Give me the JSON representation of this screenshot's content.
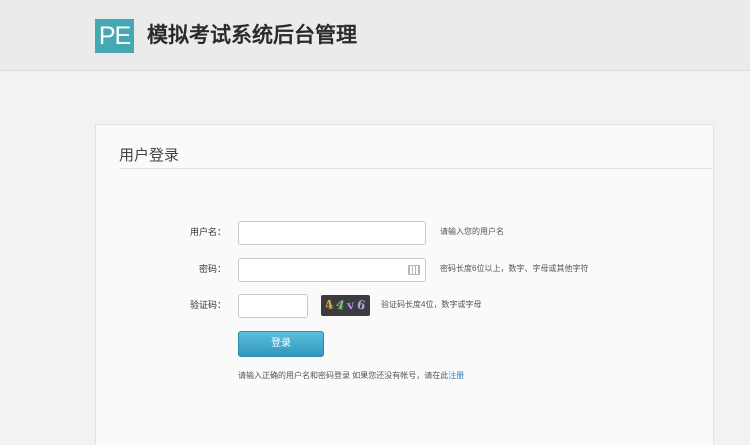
{
  "header": {
    "logo_text": "PE",
    "title": "模拟考试系统后台管理"
  },
  "login": {
    "panel_title": "用户登录",
    "username": {
      "label": "用户名：",
      "value": "",
      "hint": "请输入您的用户名"
    },
    "password": {
      "label": "密码：",
      "value": "",
      "hint": "密码长度6位以上，数字、字母或其他字符"
    },
    "captcha": {
      "label": "验证码：",
      "value": "",
      "hint": "验证码长度4位，数字或字母",
      "image_chars": [
        "4",
        "4",
        "v",
        "6"
      ]
    },
    "submit_label": "登录",
    "note_text": "请输入正确的用户名和密码登录  如果您还没有帐号，请在此",
    "register_link": "注册"
  },
  "colors": {
    "logo_bg": "#46a8b2",
    "button": "#3aa5cc",
    "link": "#2d7cc0"
  }
}
